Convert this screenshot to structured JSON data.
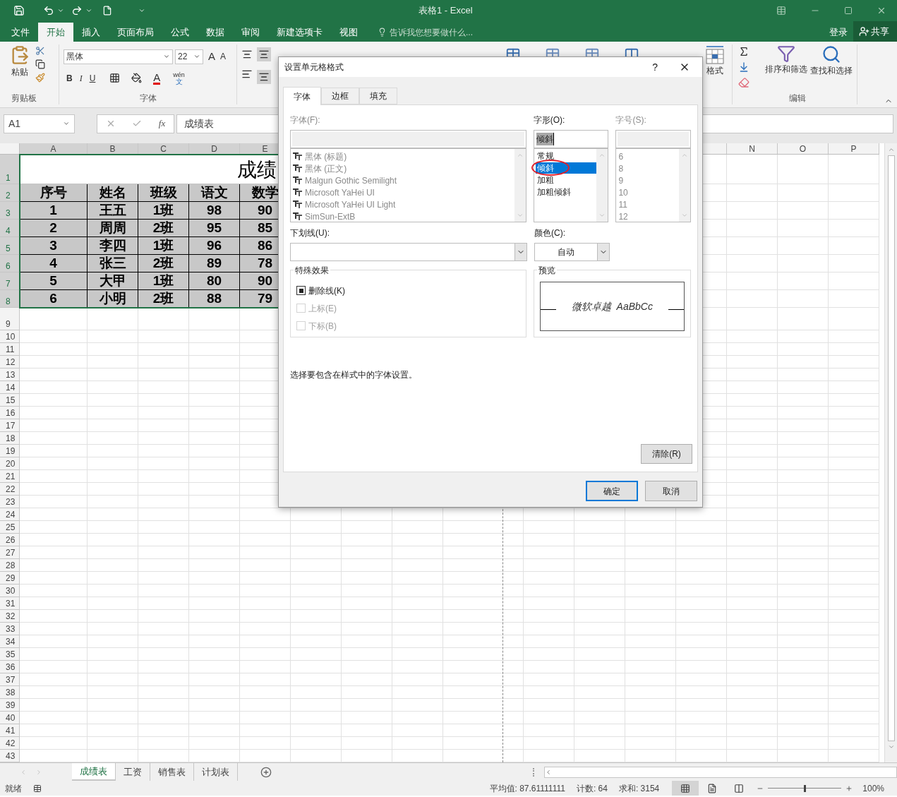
{
  "title_bar": {
    "title": "表格1 - Excel"
  },
  "menu": {
    "tabs": [
      {
        "label": "文件",
        "selected": false
      },
      {
        "label": "开始",
        "selected": true
      },
      {
        "label": "插入",
        "selected": false
      },
      {
        "label": "页面布局",
        "selected": false
      },
      {
        "label": "公式",
        "selected": false
      },
      {
        "label": "数据",
        "selected": false
      },
      {
        "label": "审阅",
        "selected": false
      },
      {
        "label": "新建选项卡",
        "selected": false
      },
      {
        "label": "视图",
        "selected": false
      }
    ],
    "tell_me": "告诉我您想要做什么...",
    "sign_in": "登录",
    "share": "共享"
  },
  "ribbon": {
    "clipboard": {
      "paste": "粘贴",
      "group": "剪贴板"
    },
    "font": {
      "name": "黑体",
      "size": "22",
      "grow": "A",
      "shrink": "A",
      "bold": "B",
      "italic": "I",
      "underline": "U",
      "font_color": "A",
      "phonetic_top": "wén",
      "phonetic_bottom": "文",
      "group": "字体"
    },
    "cells": {
      "format": "格式"
    },
    "editing": {
      "sort": "排序和筛选",
      "find": "查找和选择",
      "group": "编辑"
    }
  },
  "formula_bar": {
    "name_box": "A1",
    "fx": "fx",
    "value": "成绩表"
  },
  "sheet": {
    "columns_left": [
      "A",
      "B",
      "C",
      "D",
      "E"
    ],
    "columns_right": [
      "N",
      "O",
      "P"
    ],
    "row_numbers": [
      "1",
      "2",
      "3",
      "4",
      "5",
      "6",
      "7",
      "8",
      "9",
      "10",
      "11",
      "12",
      "13",
      "14",
      "15",
      "16",
      "17",
      "18",
      "19",
      "20",
      "21",
      "22",
      "23",
      "24",
      "25",
      "26",
      "27",
      "28",
      "29",
      "30",
      "31",
      "32",
      "33",
      "34",
      "35",
      "36",
      "37",
      "38",
      "39",
      "40",
      "41",
      "42",
      "43"
    ],
    "table": {
      "title": "成绩",
      "header": [
        "序号",
        "姓名",
        "班级",
        "语文",
        "数学"
      ],
      "rows": [
        [
          "1",
          "王五",
          "1班",
          "98",
          "90"
        ],
        [
          "2",
          "周周",
          "2班",
          "95",
          "85"
        ],
        [
          "3",
          "李四",
          "1班",
          "96",
          "86"
        ],
        [
          "4",
          "张三",
          "2班",
          "89",
          "78"
        ],
        [
          "5",
          "大甲",
          "1班",
          "80",
          "90"
        ],
        [
          "6",
          "小明",
          "2班",
          "88",
          "79"
        ]
      ]
    }
  },
  "dialog": {
    "title": "设置单元格格式",
    "help": "?",
    "tabs": [
      {
        "label": "字体",
        "selected": true
      },
      {
        "label": "边框",
        "selected": false
      },
      {
        "label": "填充",
        "selected": false
      }
    ],
    "font": {
      "label": "字体(F):",
      "disabled": true,
      "items": [
        "黑体 (标题)",
        "黑体 (正文)",
        "Malgun Gothic Semilight",
        "Microsoft YaHei UI",
        "Microsoft YaHei UI Light",
        "SimSun-ExtB"
      ]
    },
    "style": {
      "label": "字形(O):",
      "value": "倾斜",
      "items": [
        {
          "label": "常规",
          "selected": false,
          "circled": false
        },
        {
          "label": "倾斜",
          "selected": true,
          "circled": true
        },
        {
          "label": "加粗",
          "selected": false,
          "circled": false
        },
        {
          "label": "加粗倾斜",
          "selected": false,
          "circled": false
        }
      ]
    },
    "size": {
      "label": "字号(S):",
      "disabled": true,
      "items": [
        "6",
        "8",
        "9",
        "10",
        "11",
        "12"
      ]
    },
    "underline": {
      "label": "下划线(U):"
    },
    "color": {
      "label": "颜色(C):",
      "value": "自动"
    },
    "effects": {
      "label": "特殊效果",
      "options": [
        {
          "label": "删除线(K)",
          "mixed": true,
          "disabled": false
        },
        {
          "label": "上标(E)",
          "mixed": false,
          "disabled": true
        },
        {
          "label": "下标(B)",
          "mixed": false,
          "disabled": true
        }
      ]
    },
    "preview": {
      "label": "预览",
      "sample": "微软卓越  AaBbCc"
    },
    "hint": "选择要包含在样式中的字体设置。",
    "clear": "清除(R)",
    "buttons": [
      {
        "label": "确定",
        "default": true
      },
      {
        "label": "取消",
        "default": false
      }
    ]
  },
  "sheet_tabs": [
    {
      "label": "成绩表",
      "selected": true
    },
    {
      "label": "工资",
      "selected": false
    },
    {
      "label": "销售表",
      "selected": false
    },
    {
      "label": "计划表",
      "selected": false
    }
  ],
  "status_bar": {
    "ready": "就绪",
    "average": "平均值: 87.61111111",
    "count": "计数: 64",
    "sum": "求和: 3154",
    "views": [
      {
        "kind": "normal",
        "selected": true
      },
      {
        "kind": "layout",
        "selected": false
      },
      {
        "kind": "break",
        "selected": false
      }
    ],
    "zoom": {
      "level": 0.5,
      "reading": "100%"
    }
  }
}
